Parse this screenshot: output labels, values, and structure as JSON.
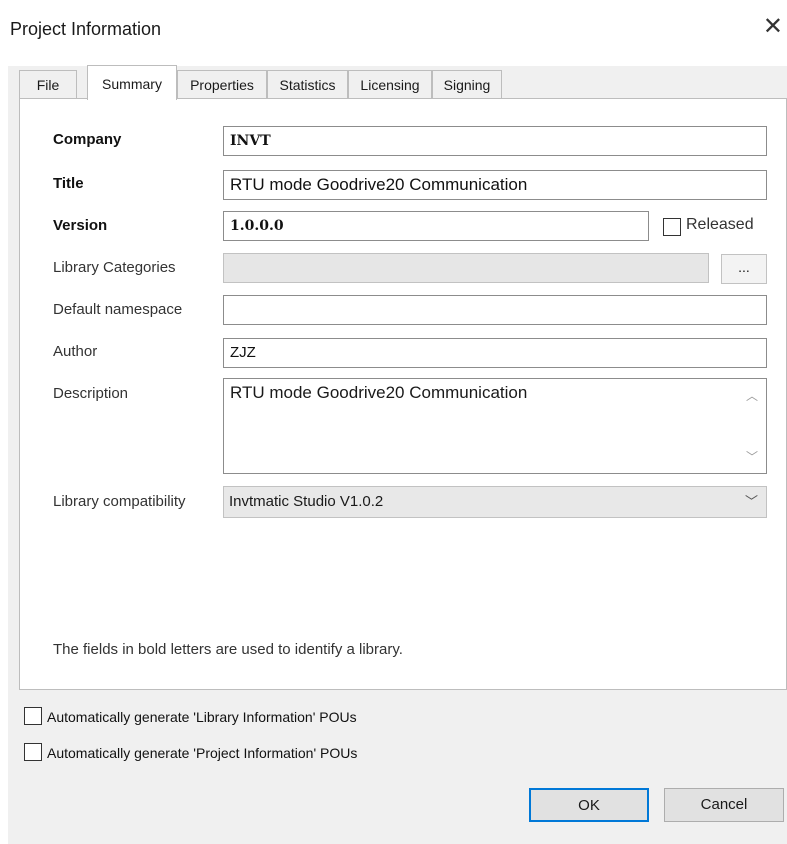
{
  "window": {
    "title": "Project Information"
  },
  "tabs": [
    {
      "label": "File"
    },
    {
      "label": "Summary"
    },
    {
      "label": "Properties"
    },
    {
      "label": "Statistics"
    },
    {
      "label": "Licensing"
    },
    {
      "label": "Signing"
    }
  ],
  "active_tab": "Summary",
  "fields": {
    "company": {
      "label": "Company",
      "value": "INVT"
    },
    "title": {
      "label": "Title",
      "value": "RTU mode Goodrive20 Communication"
    },
    "version": {
      "label": "Version",
      "value": "1.0.0.0"
    },
    "released": {
      "label": "Released",
      "checked": false
    },
    "library_categories": {
      "label": "Library Categories",
      "value": "",
      "browse_label": "..."
    },
    "default_namespace": {
      "label": "Default namespace",
      "value": ""
    },
    "author": {
      "label": "Author",
      "value": "ZJZ"
    },
    "description": {
      "label": "Description",
      "value": "RTU mode Goodrive20 Communication"
    },
    "library_compatibility": {
      "label": "Library compatibility",
      "value": "Invtmatic Studio V1.0.2"
    }
  },
  "note": "The fields in bold letters are used to identify a library.",
  "options": [
    {
      "label": "Automatically generate 'Library Information' POUs",
      "checked": false
    },
    {
      "label": "Automatically generate 'Project Information' POUs",
      "checked": false
    }
  ],
  "buttons": {
    "ok": "OK",
    "cancel": "Cancel"
  },
  "icons": {
    "close": "close-icon",
    "scroll_up": "chevron-up-icon",
    "scroll_down": "chevron-down-icon",
    "dropdown": "chevron-down-icon"
  },
  "colors": {
    "accent": "#0078d7",
    "background": "#f0f0f0"
  }
}
